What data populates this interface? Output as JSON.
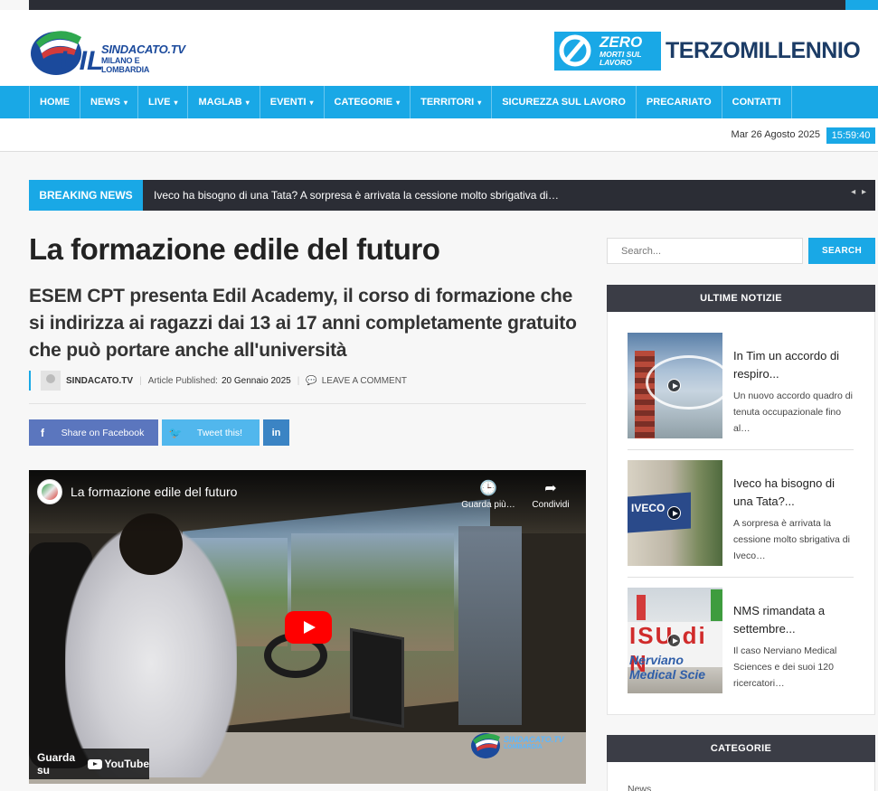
{
  "header": {
    "logo_main": "SINDACATO.TV",
    "logo_sub": "MILANO E LOMBARDIA",
    "zero_big": "ZERO",
    "zero_small_1": "MORTI SUL",
    "zero_small_2": "LAVORO",
    "terzo": "TERZOMILLENNIO"
  },
  "nav": {
    "items": [
      {
        "label": "HOME",
        "dropdown": false
      },
      {
        "label": "NEWS",
        "dropdown": true
      },
      {
        "label": "LIVE",
        "dropdown": true
      },
      {
        "label": "MAGLAB",
        "dropdown": true
      },
      {
        "label": "EVENTI",
        "dropdown": true
      },
      {
        "label": "CATEGORIE",
        "dropdown": true
      },
      {
        "label": "TERRITORI",
        "dropdown": true
      },
      {
        "label": "SICUREZZA SUL LAVORO",
        "dropdown": false
      },
      {
        "label": "PRECARIATO",
        "dropdown": false
      },
      {
        "label": "CONTATTI",
        "dropdown": false
      }
    ],
    "caret": "▾"
  },
  "datebar": {
    "date": "Mar 26 Agosto 2025",
    "time": "15:59:40"
  },
  "breaking": {
    "label": "BREAKING NEWS",
    "text": "Iveco ha bisogno di una Tata? A sorpresa è arrivata la cessione molto sbrigativa di…",
    "arrows": "◂ ▸"
  },
  "article": {
    "title": "La formazione edile del futuro",
    "subtitle": "ESEM CPT presenta Edil Academy, il corso di formazione che si indirizza ai ragazzi dai 13 ai 17 anni completamente gratuito che può portare anche all'università",
    "author": "SINDACATO.TV",
    "published_label": "Article Published:",
    "published_date": "20 Gennaio 2025",
    "comment_label": "LEAVE A COMMENT"
  },
  "share": {
    "facebook_icon": "f",
    "facebook_label": "Share on Facebook",
    "twitter_icon": "🐦",
    "twitter_label": "Tweet this!",
    "linkedin_icon": "in"
  },
  "video": {
    "title": "La formazione edile del futuro",
    "watch_later": "Guarda più…",
    "share": "Condividi",
    "watch_on": "Guarda su",
    "youtube": "YouTube",
    "watermark_1": "SINDACATO.TV",
    "watermark_2": "LOMBARDIA"
  },
  "sidebar": {
    "search_placeholder": "Search...",
    "search_button": "SEARCH",
    "latest_heading": "ULTIME NOTIZIE",
    "news": [
      {
        "title": "In Tim un accordo di respiro...",
        "excerpt": "Un nuovo accordo quadro di tenuta occupazionale fino al…"
      },
      {
        "title": "Iveco ha bisogno di una Tata?...",
        "excerpt": "A sorpresa è arrivata la cessione molto sbrigativa di Iveco…"
      },
      {
        "title": "NMS rimandata a settembre...",
        "excerpt": "Il caso Nerviano Medical Sciences e dei suoi 120 ricercatori…"
      }
    ],
    "thumb2_text": "IVECO",
    "thumb3_red": "ISU di N",
    "thumb3_blue": "Nerviano Medical Scie",
    "categories_heading": "CATEGORIE",
    "first_category": "News"
  }
}
